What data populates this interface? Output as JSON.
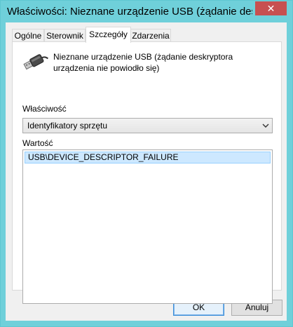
{
  "window": {
    "title": "Właściwości: Nieznane urządzenie USB (żądanie deskr",
    "close_label": "✕"
  },
  "tabs": [
    {
      "label": "Ogólne"
    },
    {
      "label": "Sterownik"
    },
    {
      "label": "Szczegóły"
    },
    {
      "label": "Zdarzenia"
    }
  ],
  "active_tab": "Szczegóły",
  "device": {
    "icon": "usb-icon",
    "name": "Nieznane urządzenie USB (żądanie deskryptora urządzenia nie powiodło się)"
  },
  "property": {
    "label": "Właściwość",
    "selected": "Identyfikatory sprzętu"
  },
  "value": {
    "label": "Wartość",
    "items": [
      "USB\\DEVICE_DESCRIPTOR_FAILURE"
    ]
  },
  "buttons": {
    "ok": "OK",
    "cancel": "Anuluj"
  },
  "colors": {
    "frame": "#6fd0da",
    "close": "#c75050",
    "selection": "#cde8ff"
  }
}
